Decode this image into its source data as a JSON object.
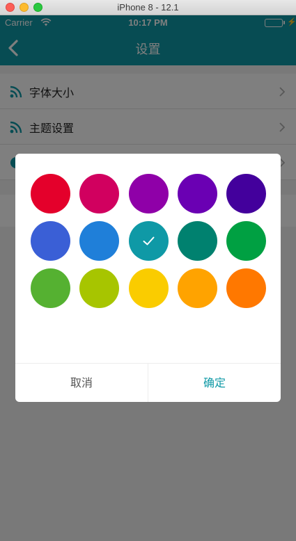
{
  "window": {
    "title": "iPhone 8 - 12.1"
  },
  "status": {
    "carrier": "Carrier",
    "time": "10:17 PM",
    "battery_level": 1.0
  },
  "nav": {
    "title": "设置",
    "back_icon": "chevron-left-icon"
  },
  "settings": {
    "items": [
      {
        "label": "字体大小",
        "icon": "rss-icon"
      },
      {
        "label": "主题设置",
        "icon": "rss-icon"
      }
    ]
  },
  "dialog": {
    "selected_index": 7,
    "colors": [
      "#e4002b",
      "#d1005f",
      "#8f00a8",
      "#6a00b3",
      "#43009c",
      "#3a5fd6",
      "#1f7fd9",
      "#0f99a6",
      "#00816f",
      "#00a042",
      "#55b131",
      "#a7c500",
      "#facc00",
      "#ffa300",
      "#ff7800"
    ],
    "cancel_label": "取消",
    "confirm_label": "确定"
  },
  "theme": {
    "accent": "#0f99a6"
  }
}
